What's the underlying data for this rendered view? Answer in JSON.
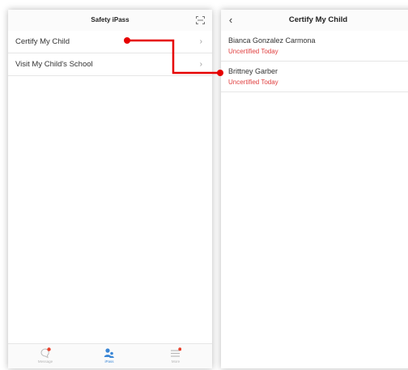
{
  "left_screen": {
    "title": "Safety iPass",
    "header_icon": "scan-icon",
    "menu": [
      {
        "label": "Certify My Child",
        "icon": "chevron-right-icon"
      },
      {
        "label": "Visit My Child's School",
        "icon": "chevron-right-icon"
      }
    ],
    "tabs": [
      {
        "label": "Message",
        "icon": "message-icon",
        "has_badge": true
      },
      {
        "label": "iPass",
        "icon": "people-icon",
        "active": true
      },
      {
        "label": "More",
        "icon": "menu-icon",
        "has_badge": true
      }
    ]
  },
  "right_screen": {
    "title": "Certify My Child",
    "back_icon": "back-arrow-icon",
    "children": [
      {
        "name": "Bianca Gonzalez Carmona",
        "status": "Uncertified Today"
      },
      {
        "name": "Brittney Garber",
        "status": "Uncertified Today"
      }
    ]
  },
  "colors": {
    "status_red": "#e04040",
    "connector_red": "#e60000",
    "active_tab_blue": "#3a86d6",
    "badge_red": "#e8412c"
  }
}
